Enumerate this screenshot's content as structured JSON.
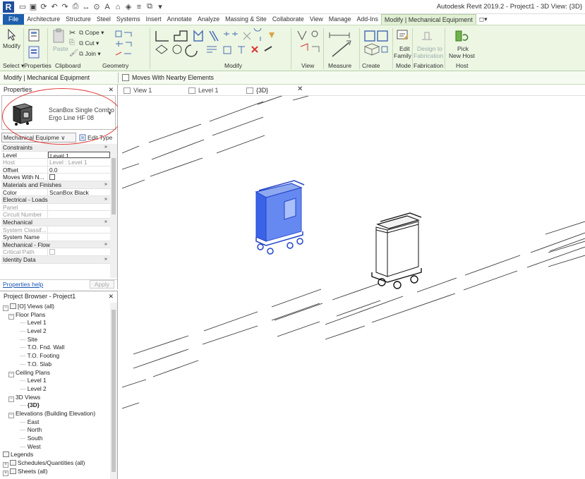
{
  "app": {
    "title": "Autodesk Revit 2019.2 - Project1 - 3D View: {3D}",
    "logo": "R",
    "qat_icons": [
      "open-icon",
      "save-icon",
      "sync-icon",
      "undo-icon",
      "redo-icon",
      "print-icon",
      "measure-icon",
      "tag-icon",
      "text-icon",
      "3d-view-icon",
      "section-icon",
      "thin-lines-icon",
      "switch-windows-icon",
      "customize-icon"
    ]
  },
  "menu": {
    "file": "File",
    "tabs": [
      "Architecture",
      "Structure",
      "Steel",
      "Systems",
      "Insert",
      "Annotate",
      "Analyze",
      "Massing & Site",
      "Collaborate",
      "View",
      "Manage",
      "Add-Ins"
    ],
    "active": "Modify | Mechanical Equipment",
    "extra": "◻▾"
  },
  "ribbon": {
    "panels": {
      "select": "Select ▾",
      "properties": "Properties",
      "clipboard": "Clipboard",
      "geometry": "Geometry",
      "modify": "Modify",
      "view": "View",
      "measure": "Measure",
      "create": "Create",
      "mode": "Mode",
      "fabrication": "Fabrication",
      "host": "Host"
    },
    "buttons": {
      "modify": "Modify",
      "paste": "Paste",
      "cope": "Cope",
      "cut": "Cut",
      "join": "Join",
      "edit_family_1": "Edit",
      "edit_family_2": "Family",
      "design_fab_1": "Design to",
      "design_fab_2": "Fabrication",
      "pick_host_1": "Pick",
      "pick_host_2": "New Host"
    }
  },
  "options_bar": {
    "context": "Modify | Mechanical Equipment",
    "checkbox_label": "Moves With Nearby Elements"
  },
  "properties": {
    "header": "Properties",
    "close": "✕",
    "type_name_1": "ScanBox Single Combo",
    "type_name_2": "Ergo Line HF 08",
    "filter": "Mechanical Equipme ∨",
    "edit_type": "Edit Type",
    "rows": [
      {
        "kind": "group",
        "k": "Constraints",
        "arr": "»"
      },
      {
        "kind": "row",
        "k": "Level",
        "v": "Level 1"
      },
      {
        "kind": "gray",
        "k": "Host",
        "v": "Level : Level 1"
      },
      {
        "kind": "row",
        "k": "Offset",
        "v": "0.0"
      },
      {
        "kind": "row",
        "k": "Moves With N...",
        "v": ""
      },
      {
        "kind": "group",
        "k": "Materials and Finishes",
        "arr": "»"
      },
      {
        "kind": "row",
        "k": "Color",
        "v": "ScanBox Black"
      },
      {
        "kind": "group",
        "k": "Electrical - Loads",
        "arr": "»"
      },
      {
        "kind": "gray",
        "k": "Panel",
        "v": ""
      },
      {
        "kind": "gray",
        "k": "Circuit Number",
        "v": ""
      },
      {
        "kind": "group",
        "k": "Mechanical",
        "arr": "»"
      },
      {
        "kind": "gray",
        "k": "System Classif...",
        "v": ""
      },
      {
        "kind": "row",
        "k": "System Name",
        "v": ""
      },
      {
        "kind": "group",
        "k": "Mechanical - Flow",
        "arr": "»"
      },
      {
        "kind": "gray",
        "k": "Critical Path",
        "v": ""
      },
      {
        "kind": "group",
        "k": "Identity Data",
        "arr": "»"
      }
    ],
    "help": "Properties help",
    "apply": "Apply"
  },
  "browser": {
    "header": "Project Browser - Project1",
    "close": "✕",
    "items": [
      {
        "indent": 0,
        "toggle": "−",
        "icon": true,
        "label": "[O] Views (all)"
      },
      {
        "indent": 1,
        "toggle": "−",
        "icon": false,
        "label": "Floor Plans"
      },
      {
        "indent": 3,
        "toggle": "",
        "icon": false,
        "label": "Level 1"
      },
      {
        "indent": 3,
        "toggle": "",
        "icon": false,
        "label": "Level 2"
      },
      {
        "indent": 3,
        "toggle": "",
        "icon": false,
        "label": "Site"
      },
      {
        "indent": 3,
        "toggle": "",
        "icon": false,
        "label": "T.O. Fnd. Wall"
      },
      {
        "indent": 3,
        "toggle": "",
        "icon": false,
        "label": "T.O. Footing"
      },
      {
        "indent": 3,
        "toggle": "",
        "icon": false,
        "label": "T.O. Slab"
      },
      {
        "indent": 1,
        "toggle": "−",
        "icon": false,
        "label": "Ceiling Plans"
      },
      {
        "indent": 3,
        "toggle": "",
        "icon": false,
        "label": "Level 1"
      },
      {
        "indent": 3,
        "toggle": "",
        "icon": false,
        "label": "Level 2"
      },
      {
        "indent": 1,
        "toggle": "−",
        "icon": false,
        "label": "3D Views"
      },
      {
        "indent": 3,
        "toggle": "",
        "icon": false,
        "label": "{3D}",
        "bold": true
      },
      {
        "indent": 1,
        "toggle": "−",
        "icon": false,
        "label": "Elevations (Building Elevation)"
      },
      {
        "indent": 3,
        "toggle": "",
        "icon": false,
        "label": "East"
      },
      {
        "indent": 3,
        "toggle": "",
        "icon": false,
        "label": "North"
      },
      {
        "indent": 3,
        "toggle": "",
        "icon": false,
        "label": "South"
      },
      {
        "indent": 3,
        "toggle": "",
        "icon": false,
        "label": "West"
      },
      {
        "indent": 0,
        "toggle": "",
        "icon": true,
        "label": "Legends"
      },
      {
        "indent": 0,
        "toggle": "+",
        "icon": true,
        "label": "Schedules/Quantities (all)"
      },
      {
        "indent": 0,
        "toggle": "+",
        "icon": true,
        "label": "Sheets (all)"
      }
    ]
  },
  "view_tabs": [
    {
      "label": "View 1",
      "active": false
    },
    {
      "label": "Level 1",
      "active": false
    },
    {
      "label": "{3D}",
      "active": true
    }
  ],
  "view_tab_close": "✕",
  "colors": {
    "ribbon_bg": "#ecf6e3",
    "file_tab": "#1d5fad",
    "selected_element": "#3a63e8",
    "annotation_circle": "#e23a3a"
  }
}
